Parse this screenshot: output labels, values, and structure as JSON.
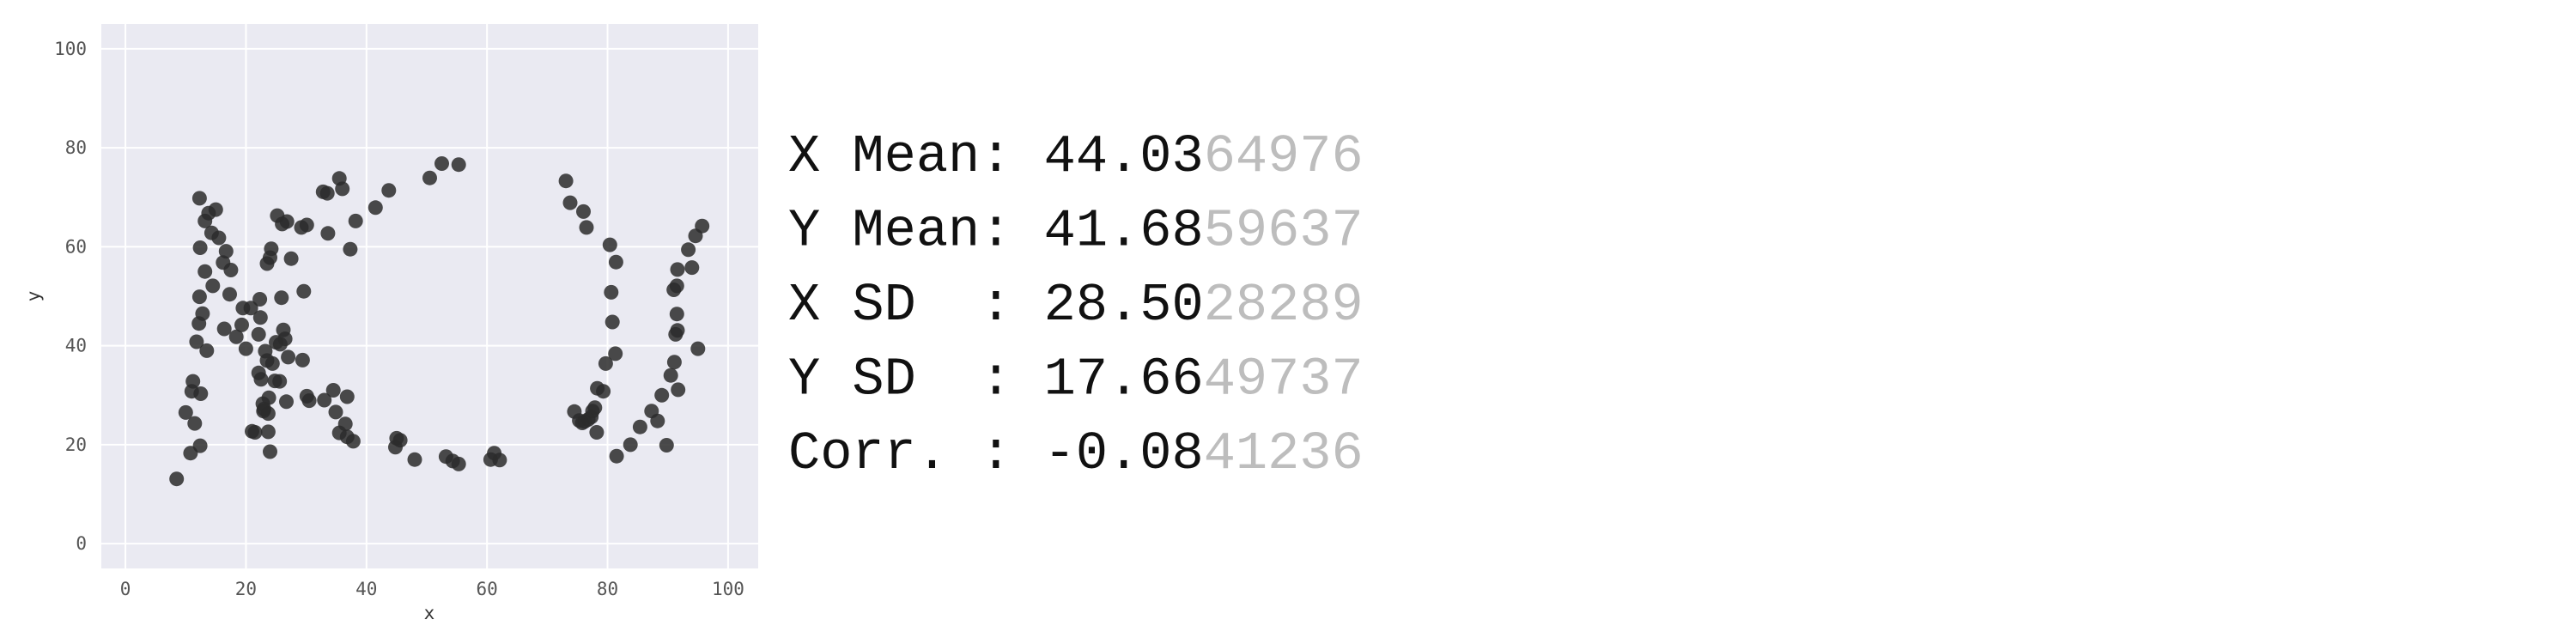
{
  "chart_data": {
    "type": "scatter",
    "title": "",
    "xlabel": "x",
    "ylabel": "y",
    "xlim": [
      -4,
      105
    ],
    "ylim": [
      -5,
      105
    ],
    "xticks": [
      0,
      20,
      40,
      60,
      80,
      100
    ],
    "yticks": [
      0,
      20,
      40,
      60,
      80,
      100
    ],
    "grid": true,
    "background": "#eaeaf2",
    "marker_color": "#2b2b2b",
    "points": [
      [
        8.5,
        13.1
      ],
      [
        10,
        26.5
      ],
      [
        10.8,
        18.3
      ],
      [
        11,
        30.8
      ],
      [
        11.2,
        32.8
      ],
      [
        11.5,
        24.3
      ],
      [
        11.8,
        40.8
      ],
      [
        12.2,
        44.5
      ],
      [
        12.3,
        49.9
      ],
      [
        12.4,
        59.8
      ],
      [
        12.3,
        69.8
      ],
      [
        12.5,
        30.3
      ],
      [
        12.4,
        19.8
      ],
      [
        12.8,
        46.5
      ],
      [
        13.2,
        55
      ],
      [
        13.5,
        39
      ],
      [
        13.2,
        65.2
      ],
      [
        13.8,
        66.8
      ],
      [
        14.3,
        62.8
      ],
      [
        14.5,
        52.1
      ],
      [
        15,
        67.5
      ],
      [
        15.5,
        61.8
      ],
      [
        16.2,
        56.8
      ],
      [
        16.4,
        43.4
      ],
      [
        16.7,
        59.1
      ],
      [
        17.5,
        55.3
      ],
      [
        17.3,
        50.4
      ],
      [
        18.4,
        41.8
      ],
      [
        19.3,
        44.2
      ],
      [
        19.5,
        47.6
      ],
      [
        20,
        39.4
      ],
      [
        20.8,
        47.6
      ],
      [
        21,
        22.7
      ],
      [
        21.5,
        22.5
      ],
      [
        22.1,
        42.3
      ],
      [
        22.1,
        34.5
      ],
      [
        22.3,
        49.4
      ],
      [
        22.4,
        45.7
      ],
      [
        22.5,
        33.2
      ],
      [
        22.8,
        28.3
      ],
      [
        22.9,
        26.8
      ],
      [
        23,
        27.2
      ],
      [
        23.2,
        38.9
      ],
      [
        23.5,
        56.6
      ],
      [
        23.5,
        37
      ],
      [
        23.7,
        26.3
      ],
      [
        23.8,
        29.5
      ],
      [
        23.7,
        22.6
      ],
      [
        24,
        57.8
      ],
      [
        24.2,
        59.6
      ],
      [
        24,
        18.6
      ],
      [
        24.4,
        36.4
      ],
      [
        24.8,
        32.9
      ],
      [
        25,
        40.7
      ],
      [
        25.2,
        66.3
      ],
      [
        25.6,
        32.8
      ],
      [
        25.7,
        40.3
      ],
      [
        25.9,
        49.7
      ],
      [
        26,
        64.6
      ],
      [
        26.2,
        43.2
      ],
      [
        26.5,
        41.4
      ],
      [
        26.7,
        28.7
      ],
      [
        26.8,
        65.1
      ],
      [
        27,
        37.7
      ],
      [
        27.5,
        57.6
      ],
      [
        29.2,
        63.9
      ],
      [
        29.4,
        37.1
      ],
      [
        29.6,
        51
      ],
      [
        30.1,
        29.8
      ],
      [
        30.1,
        64.4
      ],
      [
        30.5,
        28.9
      ],
      [
        32.8,
        71.1
      ],
      [
        33,
        29
      ],
      [
        33.5,
        70.8
      ],
      [
        33.6,
        62.7
      ],
      [
        34.5,
        31
      ],
      [
        34.9,
        26.6
      ],
      [
        35.5,
        73.8
      ],
      [
        35.5,
        22.4
      ],
      [
        36,
        71.7
      ],
      [
        36.5,
        24.2
      ],
      [
        36.8,
        29.7
      ],
      [
        36.8,
        21.6
      ],
      [
        37.3,
        59.5
      ],
      [
        37.8,
        20.7
      ],
      [
        38.2,
        65.2
      ],
      [
        41.5,
        67.9
      ],
      [
        43.7,
        71.4
      ],
      [
        44.8,
        19.5
      ],
      [
        45,
        21.3
      ],
      [
        45.6,
        20.9
      ],
      [
        48,
        17
      ],
      [
        50.5,
        73.9
      ],
      [
        52.5,
        76.8
      ],
      [
        53.2,
        17.6
      ],
      [
        54.3,
        16.7
      ],
      [
        55.3,
        16.1
      ],
      [
        55.3,
        76.6
      ],
      [
        60.6,
        17
      ],
      [
        61.2,
        18.3
      ],
      [
        62.1,
        16.9
      ],
      [
        73.1,
        73.3
      ],
      [
        73.8,
        68.9
      ],
      [
        74.5,
        26.7
      ],
      [
        75.3,
        24.9
      ],
      [
        75.8,
        24.4
      ],
      [
        76,
        67.1
      ],
      [
        76.2,
        24.7
      ],
      [
        76.5,
        63.9
      ],
      [
        76.8,
        25.1
      ],
      [
        77.3,
        25.6
      ],
      [
        77.5,
        26.8
      ],
      [
        77.9,
        27.5
      ],
      [
        78.2,
        22.5
      ],
      [
        78.3,
        31.4
      ],
      [
        79.3,
        30.8
      ],
      [
        79.7,
        36.4
      ],
      [
        80.4,
        60.4
      ],
      [
        80.6,
        50.8
      ],
      [
        80.8,
        44.8
      ],
      [
        81.4,
        56.9
      ],
      [
        81.3,
        38.4
      ],
      [
        81.5,
        17.7
      ],
      [
        83.8,
        20
      ],
      [
        85.4,
        23.6
      ],
      [
        87.3,
        26.8
      ],
      [
        88.3,
        24.8
      ],
      [
        89,
        30
      ],
      [
        89.8,
        19.9
      ],
      [
        90.5,
        34
      ],
      [
        91.0,
        51.3
      ],
      [
        91.1,
        36.7
      ],
      [
        91.3,
        42.3
      ],
      [
        91.5,
        46.4
      ],
      [
        91.6,
        55.4
      ],
      [
        91.6,
        43.1
      ],
      [
        91.5,
        52.1
      ],
      [
        91.7,
        31.1
      ],
      [
        93.4,
        59.4
      ],
      [
        94,
        55.8
      ],
      [
        94.6,
        62.2
      ],
      [
        95,
        39.4
      ],
      [
        95.7,
        64.2
      ]
    ]
  },
  "stats": [
    {
      "label": "X Mean: ",
      "value": "44.03",
      "extra": "64976"
    },
    {
      "label": "Y Mean: ",
      "value": "41.68",
      "extra": "59637"
    },
    {
      "label": "X SD  : ",
      "value": "28.50",
      "extra": "28289"
    },
    {
      "label": "Y SD  : ",
      "value": "17.66",
      "extra": "49737"
    },
    {
      "label": "Corr. : ",
      "value": "-0.08",
      "extra": "41236"
    }
  ]
}
